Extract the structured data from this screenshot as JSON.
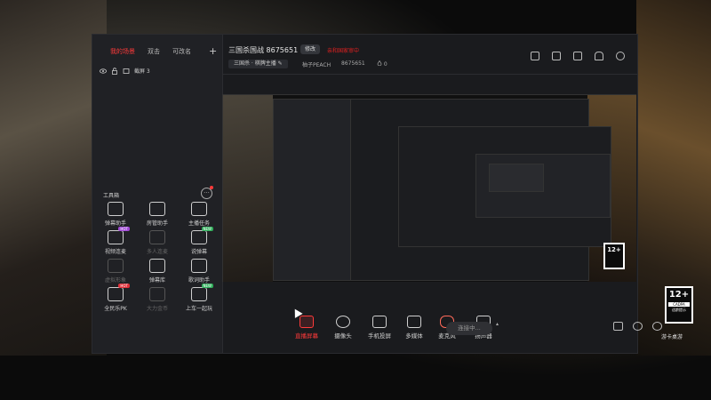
{
  "sidebar": {
    "tabs": [
      "我的场景",
      "双击",
      "可改名"
    ],
    "add_tab_icon": "+",
    "scene_label": "截屏 3",
    "tools_title": "工具箱",
    "tools_more_icon": "···",
    "tools": [
      {
        "label": "弹幕助手",
        "icon": "danmaku-icon",
        "tag": ""
      },
      {
        "label": "房管助手",
        "icon": "shield-icon",
        "tag": ""
      },
      {
        "label": "主播任务",
        "icon": "task-icon",
        "tag": ""
      },
      {
        "label": "视频连麦",
        "icon": "video-link-icon",
        "tag": "HOT"
      },
      {
        "label": "多人连麦",
        "icon": "multi-link-icon",
        "tag": "",
        "dim": true
      },
      {
        "label": "说弹幕",
        "icon": "speak-danmaku-icon",
        "tag": "NEW"
      },
      {
        "label": "虚拟形象",
        "icon": "avatar-icon",
        "tag": "",
        "dim": true
      },
      {
        "label": "弹幕库",
        "icon": "danmaku-lib-icon",
        "tag": ""
      },
      {
        "label": "歌词助手",
        "icon": "lyrics-icon",
        "tag": ""
      },
      {
        "label": "全民乐PK",
        "icon": "pk-icon",
        "tag": "HOT"
      },
      {
        "label": "大力金币",
        "icon": "coin-icon",
        "tag": "",
        "dim": true
      },
      {
        "label": "上车一起玩",
        "icon": "car-icon",
        "tag": "NEW"
      }
    ]
  },
  "header": {
    "room_title": "三国杀国战 8675651",
    "edit_label": "修改",
    "notice": "亲和国家审中",
    "category": "三国杀 · 棋牌主播 ✎",
    "streamer": "柚子PEACH",
    "room_id": "8675651",
    "likes": "0"
  },
  "badge": {
    "age": "12+",
    "line1": "CADPA",
    "line2": "适龄提示"
  },
  "brand_text": "游卡桌游",
  "bottom": {
    "tools": [
      {
        "label": "直播屏幕",
        "active": true
      },
      {
        "label": "摄像头",
        "active": false
      },
      {
        "label": "手机投屏",
        "active": false
      },
      {
        "label": "多媒体",
        "active": false
      },
      {
        "label": "麦克风",
        "active": false
      },
      {
        "label": "扬声器",
        "active": false
      }
    ],
    "live_button": "连接中..."
  },
  "colors": {
    "accent": "#ff3a3a",
    "panel": "#202125",
    "window": "#1a1b1e"
  }
}
